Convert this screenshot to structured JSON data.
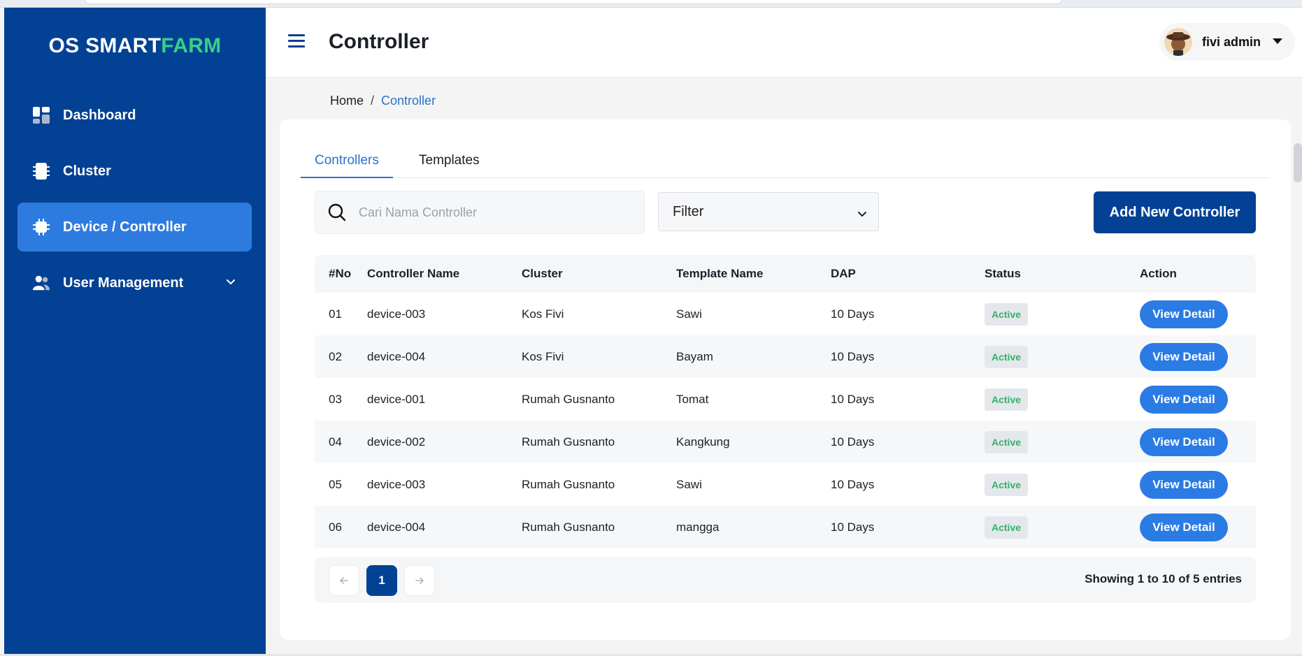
{
  "brand": {
    "prefix": "OS SMART",
    "accent": "FARM"
  },
  "sidebar": {
    "items": [
      {
        "label": "Dashboard",
        "icon": "dashboard-icon",
        "active": false
      },
      {
        "label": "Cluster",
        "icon": "cluster-icon",
        "active": false
      },
      {
        "label": "Device / Controller",
        "icon": "chip-icon",
        "active": true
      },
      {
        "label": "User Management",
        "icon": "users-icon",
        "active": false,
        "expandable": true
      }
    ]
  },
  "header": {
    "title": "Controller",
    "user_name": "fivi admin"
  },
  "breadcrumb": {
    "home": "Home",
    "separator": "/",
    "current": "Controller"
  },
  "tabs": [
    {
      "label": "Controllers",
      "active": true
    },
    {
      "label": "Templates",
      "active": false
    }
  ],
  "toolbar": {
    "search_placeholder": "Cari Nama Controller",
    "filter_label": "Filter",
    "add_button": "Add New Controller"
  },
  "table": {
    "columns": [
      "#No",
      "Controller Name",
      "Cluster",
      "Template Name",
      "DAP",
      "Status",
      "Action"
    ],
    "rows": [
      {
        "no": "01",
        "name": "device-003",
        "cluster": "Kos Fivi",
        "template": "Sawi",
        "dap": "10 Days",
        "status": "Active",
        "action": "View Detail"
      },
      {
        "no": "02",
        "name": "device-004",
        "cluster": "Kos Fivi",
        "template": "Bayam",
        "dap": "10 Days",
        "status": "Active",
        "action": "View Detail"
      },
      {
        "no": "03",
        "name": "device-001",
        "cluster": "Rumah Gusnanto",
        "template": "Tomat",
        "dap": "10 Days",
        "status": "Active",
        "action": "View Detail"
      },
      {
        "no": "04",
        "name": "device-002",
        "cluster": "Rumah Gusnanto",
        "template": "Kangkung",
        "dap": "10 Days",
        "status": "Active",
        "action": "View Detail"
      },
      {
        "no": "05",
        "name": "device-003",
        "cluster": "Rumah Gusnanto",
        "template": "Sawi",
        "dap": "10 Days",
        "status": "Active",
        "action": "View Detail"
      },
      {
        "no": "06",
        "name": "device-004",
        "cluster": "Rumah Gusnanto",
        "template": "mangga",
        "dap": "10 Days",
        "status": "Active",
        "action": "View Detail"
      }
    ]
  },
  "pagination": {
    "current_page": "1",
    "prev_icon": "arrow-left-icon",
    "next_icon": "arrow-right-icon",
    "summary": "Showing 1 to 10 of 5 entries"
  },
  "colors": {
    "sidebar": "#034194",
    "active_nav": "#2e7be0",
    "accent_green": "#35d18a",
    "primary_button": "#2a7be4",
    "status_green": "#2fb36b"
  }
}
